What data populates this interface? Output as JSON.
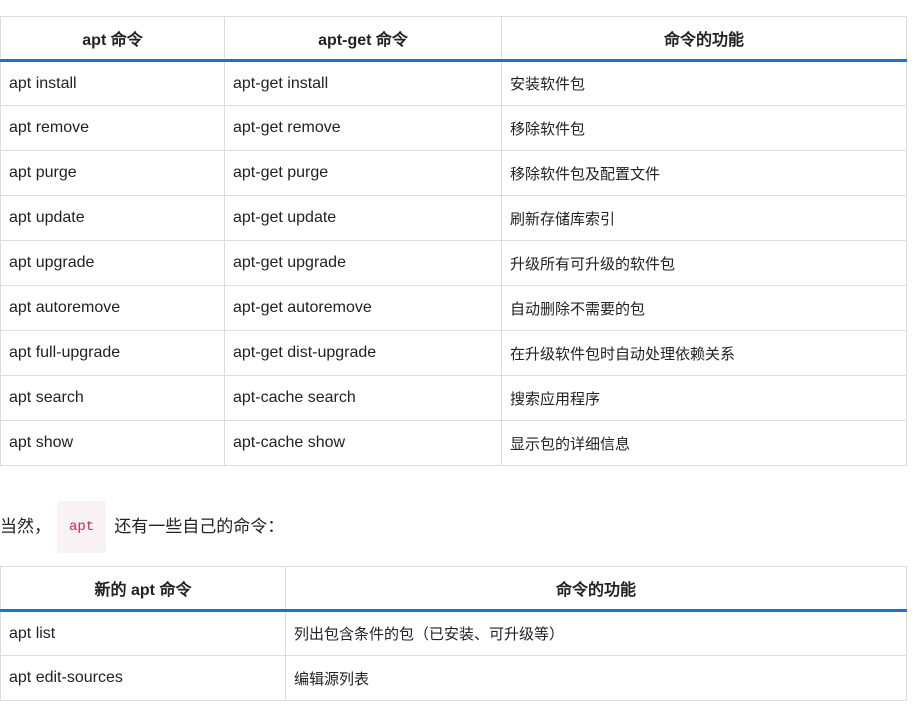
{
  "table1": {
    "headers": [
      "apt 命令",
      "apt-get 命令",
      "命令的功能"
    ],
    "rows": [
      [
        "apt install",
        "apt-get install",
        "安装软件包"
      ],
      [
        "apt remove",
        "apt-get remove",
        "移除软件包"
      ],
      [
        "apt purge",
        "apt-get purge",
        "移除软件包及配置文件"
      ],
      [
        "apt update",
        "apt-get update",
        "刷新存储库索引"
      ],
      [
        "apt upgrade",
        "apt-get upgrade",
        "升级所有可升级的软件包"
      ],
      [
        "apt autoremove",
        "apt-get autoremove",
        "自动删除不需要的包"
      ],
      [
        "apt full-upgrade",
        "apt-get dist-upgrade",
        "在升级软件包时自动处理依赖关系"
      ],
      [
        "apt search",
        "apt-cache search",
        "搜索应用程序"
      ],
      [
        "apt show",
        "apt-cache show",
        "显示包的详细信息"
      ]
    ]
  },
  "intro": {
    "prefix": "当然，",
    "code": "apt",
    "suffix": "还有一些自己的命令："
  },
  "table2": {
    "headers": [
      "新的 apt 命令",
      "命令的功能"
    ],
    "rows": [
      [
        "apt list",
        "列出包含条件的包（已安装、可升级等）"
      ],
      [
        "apt edit-sources",
        "编辑源列表"
      ]
    ]
  },
  "colors": {
    "header_rule": "#1b74c5",
    "border": "#dddddd",
    "code_text": "#c7254e",
    "code_bg": "#f9f2f4"
  }
}
